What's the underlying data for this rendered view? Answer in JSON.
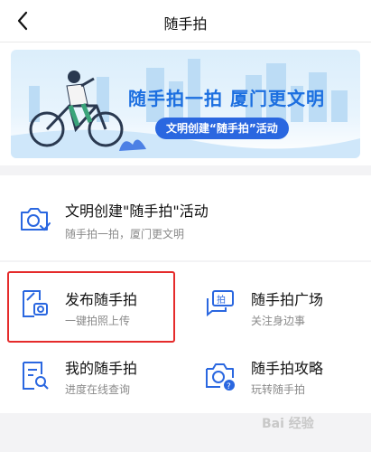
{
  "header": {
    "title": "随手拍"
  },
  "banner": {
    "headline": "随手拍一拍 厦门更文明",
    "pill": "文明创建“随手拍”活动"
  },
  "activity": {
    "title": "文明创建\"随手拍\"活动",
    "subtitle": "随手拍一拍，厦门更文明"
  },
  "grid": [
    {
      "title": "发布随手拍",
      "subtitle": "一键拍照上传"
    },
    {
      "title": "随手拍广场",
      "subtitle": "关注身边事"
    },
    {
      "title": "我的随手拍",
      "subtitle": "进度在线查询"
    },
    {
      "title": "随手拍攻略",
      "subtitle": "玩转随手拍"
    }
  ],
  "watermark": "Bai 经验",
  "colors": {
    "accent": "#2a67e0",
    "highlight_border": "#e52b2b"
  }
}
